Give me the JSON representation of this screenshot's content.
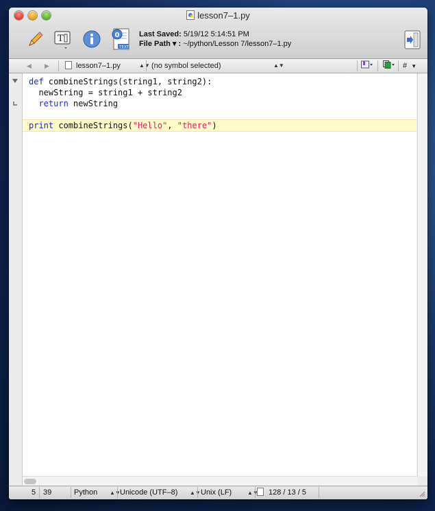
{
  "window": {
    "title": "lesson7–1.py"
  },
  "toolbar": {
    "last_saved_label": "Last Saved:",
    "last_saved_value": "5/19/12 5:14:51 PM",
    "file_path_label": "File Path ▾ :",
    "file_path_value": "~/python/Lesson 7/lesson7–1.py"
  },
  "navbar": {
    "back": "◀",
    "forward": "▶",
    "file_name": "lesson7–1.py",
    "symbol": "(no symbol selected)",
    "hash": "#"
  },
  "code": [
    [
      "def",
      " combineStrings(string1, string2):"
    ],
    [
      "  newString = string1 + string2"
    ],
    [
      "  return",
      " newString"
    ],
    [
      ""
    ],
    [
      "print",
      " combineStrings(",
      "\"Hello\"",
      ", ",
      "\"there\"",
      ")"
    ]
  ],
  "statusbar": {
    "line": "5",
    "column": "39",
    "language": "Python",
    "encoding": "Unicode (UTF–8)",
    "line_endings": "Unix (LF)",
    "counts": "128 / 13 / 5"
  },
  "colors": {
    "keyword": "#1c2bb8",
    "string": "#e01f5e",
    "current_line": "#fffcc8"
  }
}
